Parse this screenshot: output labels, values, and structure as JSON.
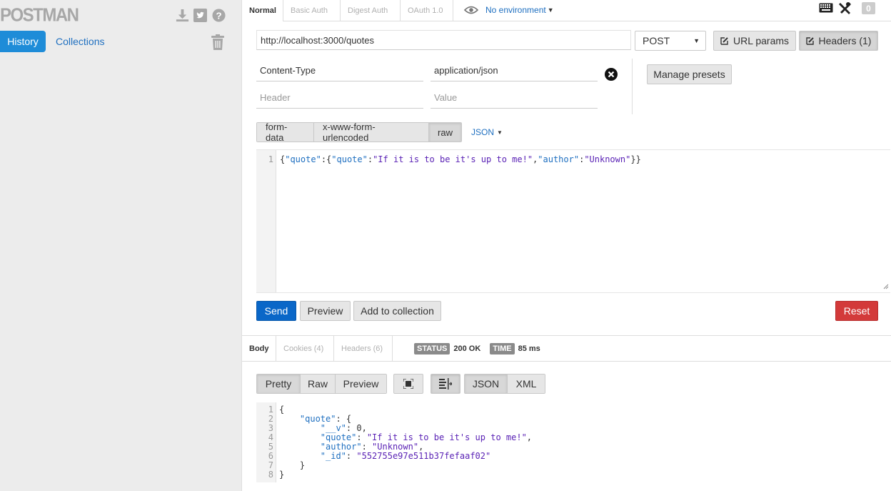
{
  "app": {
    "logo": "POSTMAN"
  },
  "sidebar": {
    "tabs": [
      {
        "label": "History"
      },
      {
        "label": "Collections"
      }
    ]
  },
  "request_tabs": [
    "Normal",
    "Basic Auth",
    "Digest Auth",
    "OAuth 1.0"
  ],
  "environment": {
    "label": "No environment"
  },
  "counter": "0",
  "request": {
    "url": "http://localhost:3000/quotes",
    "method": "POST",
    "url_params_label": "URL params",
    "headers_label": "Headers (1)",
    "headers": [
      {
        "key": "Content-Type",
        "value": "application/json"
      }
    ],
    "header_placeholder": "Header",
    "value_placeholder": "Value",
    "manage_presets_label": "Manage presets",
    "body_modes": [
      "form-data",
      "x-www-form-urlencoded",
      "raw"
    ],
    "body_format": "JSON",
    "body_line_number": "1",
    "body_parts": [
      "{",
      "\"quote\"",
      ":{",
      "\"quote\"",
      ":",
      "\"If it is to be it's up to me!\"",
      ",",
      "\"author\"",
      ":",
      "\"Unknown\"",
      "}}"
    ]
  },
  "actions": {
    "send": "Send",
    "preview": "Preview",
    "add_to_collection": "Add to collection",
    "reset": "Reset"
  },
  "response": {
    "tabs": [
      "Body",
      "Cookies (4)",
      "Headers (6)"
    ],
    "status_label": "STATUS",
    "status_value": "200 OK",
    "time_label": "TIME",
    "time_value": "85 ms",
    "view_modes": [
      "Pretty",
      "Raw",
      "Preview"
    ],
    "formats": [
      "JSON",
      "XML"
    ],
    "line_numbers": [
      "1",
      "2",
      "3",
      "4",
      "5",
      "6",
      "7",
      "8"
    ],
    "lines": [
      [
        "{"
      ],
      [
        "    ",
        "\"quote\"",
        ": {"
      ],
      [
        "        ",
        "\"__v\"",
        ": 0,"
      ],
      [
        "        ",
        "\"quote\"",
        ": ",
        "\"If it is to be it's up to me!\"",
        ","
      ],
      [
        "        ",
        "\"author\"",
        ": ",
        "\"Unknown\"",
        ","
      ],
      [
        "        ",
        "\"_id\"",
        ": ",
        "\"552755e97e511b37fefaaf02\""
      ],
      [
        "    }"
      ],
      [
        "}"
      ]
    ]
  },
  "colors": {
    "accent": "#1e8cd8",
    "send": "#0a67c8",
    "reset": "#d33a3a"
  }
}
